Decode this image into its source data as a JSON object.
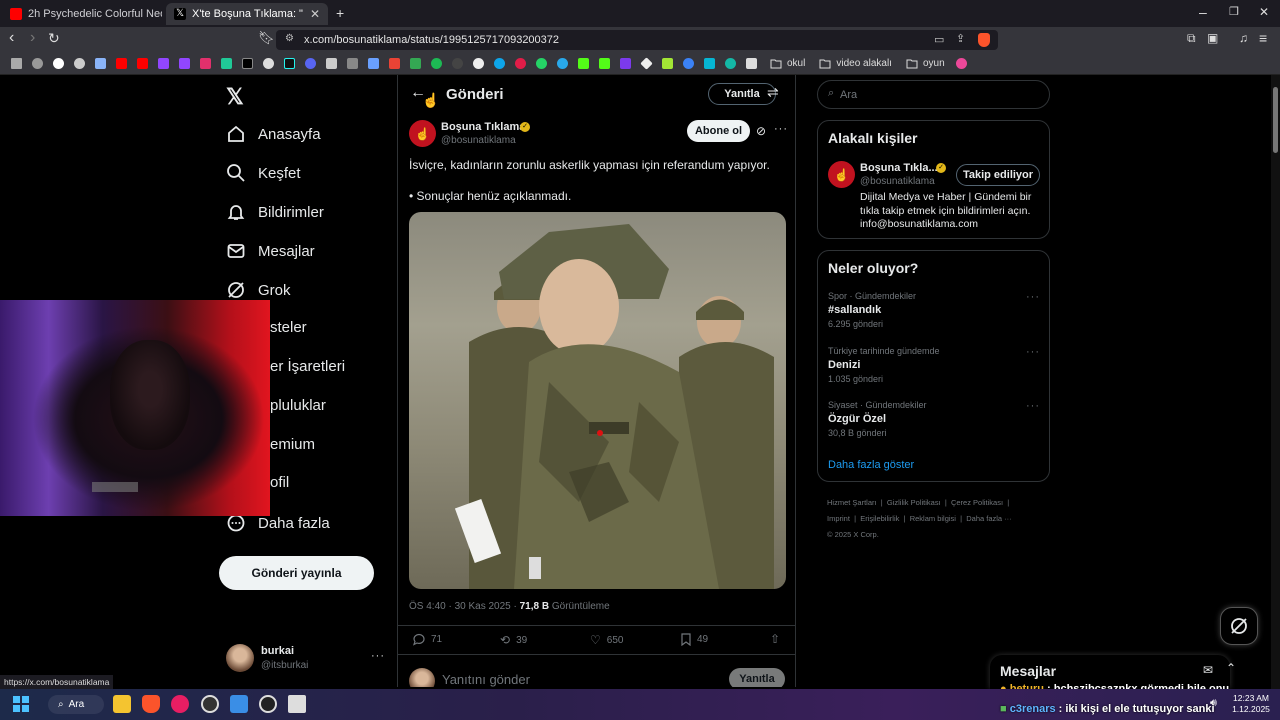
{
  "browser": {
    "tabs": [
      {
        "title": "2h Psychedelic Colorful Neon Backgr"
      },
      {
        "title": "X'te Boşuna Tıklama: \"İsviçre, ka"
      }
    ],
    "url": "x.com/bosunatiklama/status/1995125717093200372",
    "bookmark_folders": [
      "okul",
      "video alakalı",
      "oyun"
    ],
    "status_url": "https://x.com/bosunatiklama"
  },
  "nav": {
    "items": [
      {
        "label": "Anasayfa"
      },
      {
        "label": "Keşfet"
      },
      {
        "label": "Bildirimler"
      },
      {
        "label": "Mesajlar"
      },
      {
        "label": "Grok"
      },
      {
        "label": "steler"
      },
      {
        "label": "er İşaretleri"
      },
      {
        "label": "pluluklar"
      },
      {
        "label": "emium"
      },
      {
        "label": "ofil"
      },
      {
        "label": "Daha fazla"
      }
    ],
    "post_button": "Gönderi yayınla",
    "account": {
      "name": "burkai",
      "handle": "@itsburkai"
    }
  },
  "post": {
    "header_title": "Gönderi",
    "reply_button": "Yanıtla",
    "author_name": "Boşuna Tıklama",
    "author_handle": "@bosunatiklama",
    "follow_button": "Abone ol",
    "text1": "İsviçre, kadınların zorunlu askerlik yapması için referandum yapıyor.",
    "text2": "• Sonuçlar henüz açıklanmadı.",
    "time": "ÖS 4:40 · 30 Kas 2025 · ",
    "views": "71,8 B",
    "views_label": " Görüntüleme",
    "stats": {
      "replies": "71",
      "reposts": "39",
      "likes": "650",
      "bookmarks": "49"
    },
    "reply_placeholder": "Yanıtını gönder",
    "reply_submit": "Yanıtla"
  },
  "sidebar": {
    "search_placeholder": "Ara",
    "related_title": "Alakalı kişiler",
    "related": {
      "name": "Boşuna Tıkla...",
      "handle": "@bosunatiklama",
      "button": "Takip ediliyor",
      "bio": "Dijital Medya ve Haber | Gündemi bir tıkla takip etmek için bildirimleri açın. info@bosunatiklama.com"
    },
    "trends_title": "Neler oluyor?",
    "trends": [
      {
        "meta": "Spor · Gündemdekiler",
        "title": "#sallandık",
        "count": "6.295 gönderi"
      },
      {
        "meta": "Türkiye tarihinde gündemde",
        "title": "Denizi",
        "count": "1.035 gönderi"
      },
      {
        "meta": "Siyaset · Gündemdekiler",
        "title": "Özgür Özel",
        "count": "30,8 B gönderi"
      }
    ],
    "show_more": "Daha fazla göster",
    "footer": [
      "Hizmet Şartları",
      "Gizlilik Politikası",
      "Çerez Politikası",
      "Imprint",
      "Erişilebilirlik",
      "Reklam bilgisi",
      "Daha fazla ···",
      "© 2025 X Corp."
    ]
  },
  "messages": {
    "title": "Mesajlar",
    "chat": [
      {
        "user": "beturu",
        "text": " : bchszjbcsaznkx görmedi bile onu"
      },
      {
        "user": "c3renars",
        "text": " : iki kişi el ele tutuşuyor sanki"
      }
    ]
  },
  "taskbar": {
    "search": "Ara",
    "time": "12:23 AM",
    "date": "1.12.2025"
  },
  "colors": {
    "accent": "#1d9bf0",
    "verified": "#e2b719",
    "brave": "#fb542b"
  }
}
